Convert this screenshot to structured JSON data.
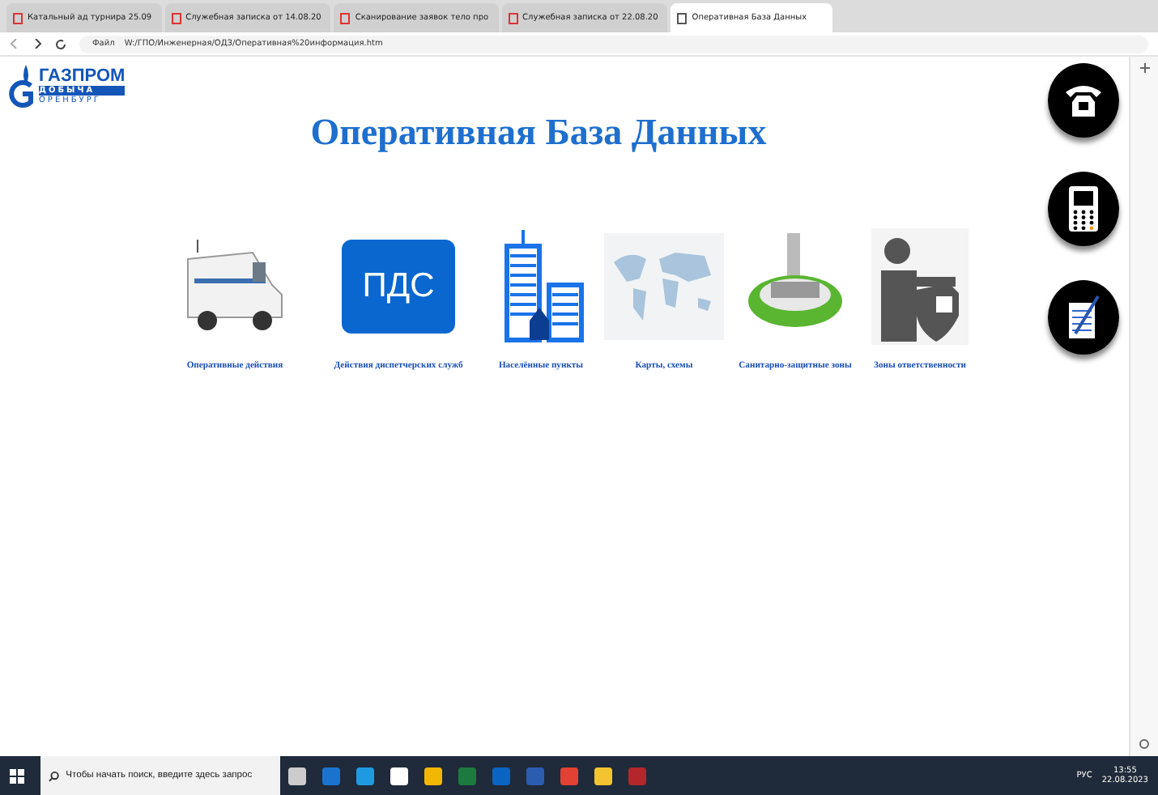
{
  "browser": {
    "tabs": [
      {
        "title": "Катальный ад турнира 25.09",
        "selected": false
      },
      {
        "title": "Служебная записка от 14.08.20",
        "selected": false
      },
      {
        "title": "Сканирование заявок тело про",
        "selected": false
      },
      {
        "title": "Служебная записка от 22.08.20",
        "selected": false
      },
      {
        "title": "Оперативная База Данных",
        "selected": true
      }
    ],
    "address": {
      "scheme": "Файл",
      "url": "W:/ГПО/Инженерная/ОДЗ/Оперативная%20информация.htm"
    }
  },
  "logo": {
    "line_1": "ГАЗПРОМ",
    "line_2": "ДОБЫЧА",
    "line_3": "ОРЕНБУРГ"
  },
  "title": "Оперативная База Данных",
  "sections": [
    {
      "kind": "van",
      "label": "Оперативные действия"
    },
    {
      "kind": "badge",
      "badge": "ПДС",
      "label": "Действия диспетчерских служб"
    },
    {
      "kind": "buildings",
      "label": "Населённые пункты"
    },
    {
      "kind": "map",
      "label": "Карты, схемы"
    },
    {
      "kind": "plant",
      "label": "Санитарно-защитные зоны"
    },
    {
      "kind": "guard",
      "label": "Зоны ответственности"
    }
  ],
  "contact_buttons": [
    {
      "kind": "phone"
    },
    {
      "kind": "mobile"
    },
    {
      "kind": "note"
    }
  ],
  "taskbar": {
    "search_placeholder": "Чтобы начать поиск, введите здесь запрос",
    "language": "РУС",
    "time": "13:55",
    "date": "22.08.2023"
  }
}
